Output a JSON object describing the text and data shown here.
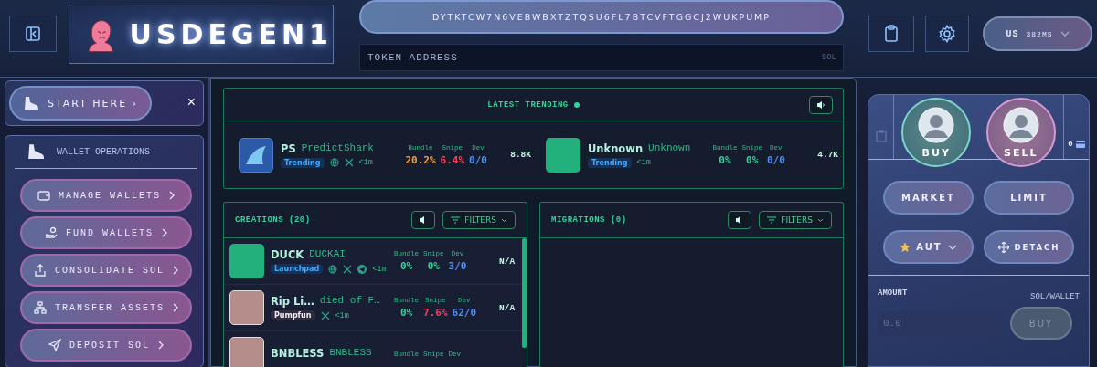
{
  "header": {
    "logo_text": "USDEGEN1",
    "contract_address": "DYTKTCW7N6VEBWBXTZTQSU6FL7BTCVFTGGCJ2WUKPUMP",
    "token_field": {
      "placeholder": "TOKEN ADDRESS",
      "suffix": "SOL"
    },
    "region": {
      "code": "US",
      "latency": "382MS"
    }
  },
  "sidebar": {
    "start": {
      "label": "START HERE ›",
      "close": "×"
    },
    "section_title": "WALLET OPERATIONS",
    "items": [
      {
        "kind": "wallet",
        "label": "MANAGE WALLETS"
      },
      {
        "kind": "fund",
        "label": "FUND WALLETS"
      },
      {
        "kind": "upload",
        "label": "CONSOLIDATE SOL"
      },
      {
        "kind": "tree",
        "label": "TRANSFER ASSETS"
      },
      {
        "kind": "send",
        "label": "DEPOSIT SOL"
      }
    ]
  },
  "trending": {
    "title": "LATEST TRENDING",
    "live": true,
    "items": [
      {
        "kind": "shark",
        "symbol": "PS",
        "name": "PredictShark",
        "tag": "Trending",
        "links": [
          {
            "kind": "web"
          },
          {
            "kind": "x"
          }
        ],
        "age": "<1m",
        "stats": [
          {
            "label": "Bundle",
            "value": "20.2%",
            "color": "#f59e42"
          },
          {
            "label": "Snipe",
            "value": "6.4%",
            "color": "#f0435a"
          },
          {
            "label": "Dev",
            "value": "0/0",
            "color": "#4f8ff7"
          }
        ],
        "mcap": "8.8K"
      },
      {
        "kind": "blank",
        "symbol": "Unknown",
        "name": "Unknown",
        "tag": "Trending",
        "age": "<1m",
        "stats": [
          {
            "label": "Bundle",
            "value": "0%",
            "color": "#34d399"
          },
          {
            "label": "Snipe",
            "value": "0%",
            "color": "#34d399"
          },
          {
            "label": "Dev",
            "value": "0/0",
            "color": "#4f8ff7"
          }
        ],
        "mcap": "4.7K"
      }
    ]
  },
  "creations": {
    "title": "CREATIONS (20)",
    "filters": "FILTERS",
    "items": [
      {
        "kind": "blank",
        "symbol": "DUCK",
        "name": "DUCKAI",
        "tag": {
          "label": "Launchpad",
          "kind": "launchpad"
        },
        "links": [
          {
            "kind": "web"
          },
          {
            "kind": "x"
          },
          {
            "kind": "telegram"
          }
        ],
        "age": "<1m",
        "stats": [
          {
            "label": "Bundle",
            "value": "0%",
            "color": "#34d399"
          },
          {
            "label": "Snipe",
            "value": "0%",
            "color": "#34d399"
          },
          {
            "label": "Dev",
            "value": "3/0",
            "color": "#4f8ff7"
          }
        ],
        "mcap": "N/A"
      },
      {
        "kind": "photo",
        "symbol": "Rip Li…",
        "name": "died of F…",
        "tag": {
          "label": "Pumpfun",
          "kind": "pumpfun"
        },
        "links": [
          {
            "kind": "x"
          }
        ],
        "age": "<1m",
        "stats": [
          {
            "label": "Bundle",
            "value": "0%",
            "color": "#34d399"
          },
          {
            "label": "Snipe",
            "value": "7.6%",
            "color": "#f0435a"
          },
          {
            "label": "Dev",
            "value": "62/0",
            "color": "#4f8ff7"
          }
        ],
        "mcap": "N/A"
      },
      {
        "kind": "photo",
        "symbol": "BNBLESS",
        "name": "BNBLESS",
        "stats": [
          {
            "label": "Bundle"
          },
          {
            "label": "Snipe"
          },
          {
            "label": "Dev"
          }
        ]
      }
    ]
  },
  "migrations": {
    "title": "MIGRATIONS (0)",
    "filters": "FILTERS"
  },
  "trade": {
    "wallet_count": "0",
    "buy": "BUY",
    "sell": "SELL",
    "order_types": [
      {
        "label": "MARKET",
        "selected": false
      },
      {
        "label": "LIMIT",
        "selected": false
      }
    ],
    "preset": "AUT",
    "detach": "DETACH",
    "amount_label": "AMOUNT",
    "unit": "SOL/WALLET",
    "amount_placeholder": "0.0",
    "submit": "BUY"
  }
}
